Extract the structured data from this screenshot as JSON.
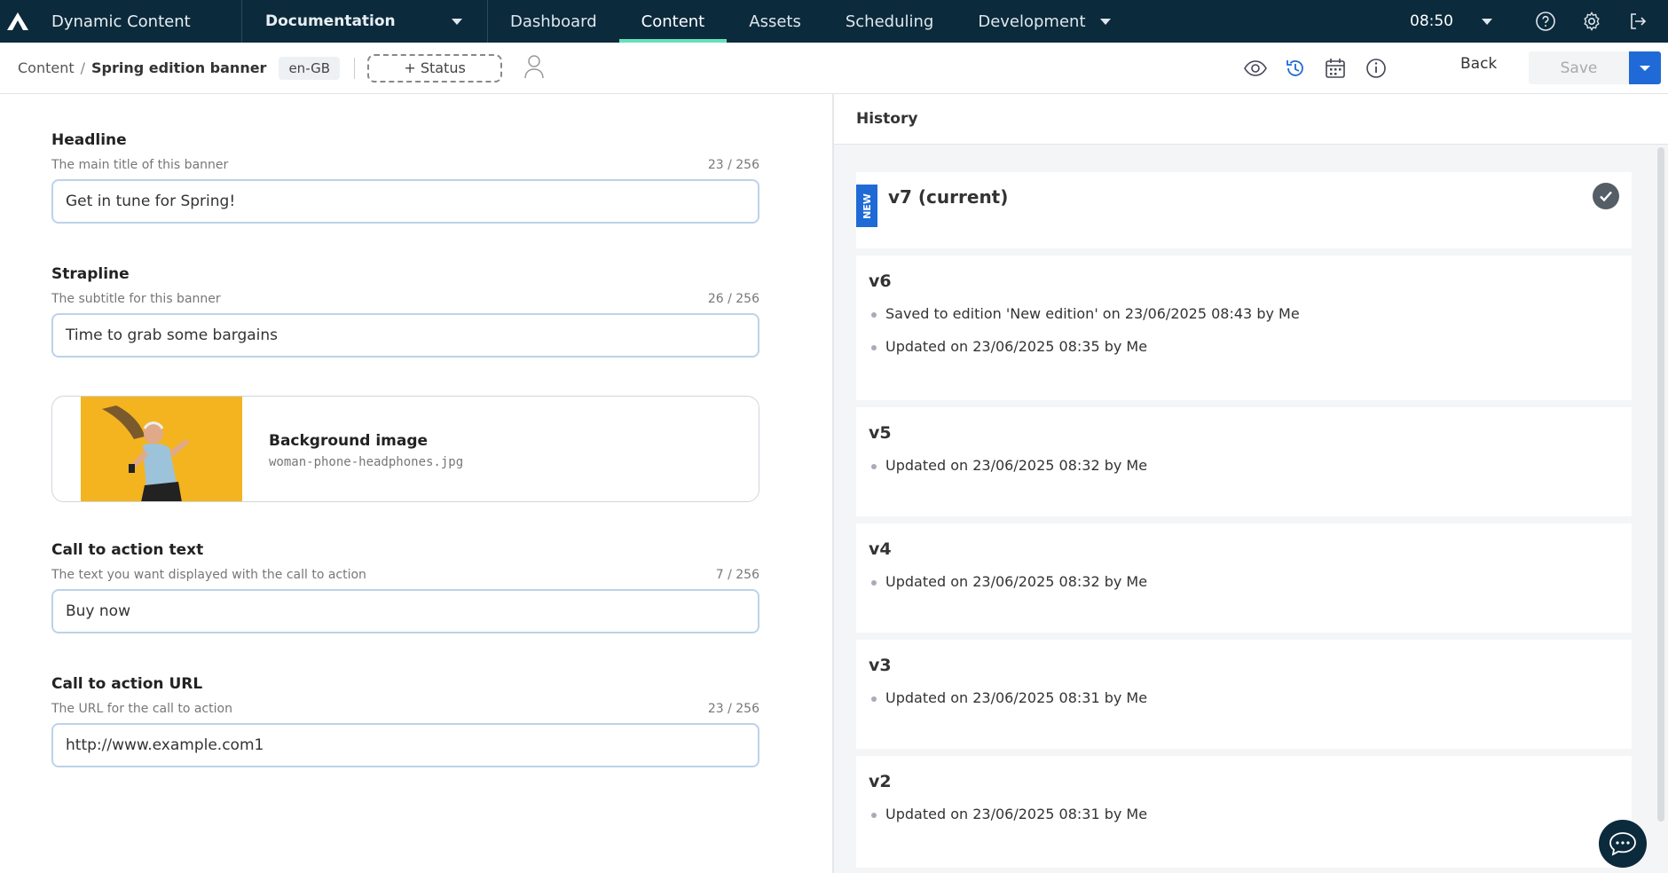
{
  "app": {
    "title": "Dynamic Content",
    "hub": "Documentation"
  },
  "nav": {
    "tabs": [
      "Dashboard",
      "Content",
      "Assets",
      "Scheduling",
      "Development"
    ],
    "active": "Content"
  },
  "clock": "08:50",
  "breadcrumb": {
    "root": "Content",
    "separator": "/",
    "current": "Spring edition banner"
  },
  "locale": "en-GB",
  "toolbar": {
    "status_label": "+ Status",
    "back_label": "Back",
    "save_label": "Save"
  },
  "form": {
    "headline": {
      "label": "Headline",
      "description": "The main title of this banner",
      "count": "23 / 256",
      "value": "Get in tune for Spring!"
    },
    "strapline": {
      "label": "Strapline",
      "description": "The subtitle for this banner",
      "count": "26 / 256",
      "value": "Time to grab some bargains"
    },
    "background_image": {
      "label": "Background image",
      "filename": "woman-phone-headphones.jpg"
    },
    "cta_text": {
      "label": "Call to action text",
      "description": "The text you want displayed with the call to action",
      "count": "7 / 256",
      "value": "Buy now"
    },
    "cta_url": {
      "label": "Call to action URL",
      "description": "The URL for the call to action",
      "count": "23 / 256",
      "value": "http://www.example.com1"
    }
  },
  "history": {
    "title": "History",
    "current": {
      "badge": "NEW",
      "name": "v7 (current)"
    },
    "versions": [
      {
        "name": "v6",
        "entries": [
          "Saved to edition 'New edition' on 23/06/2025 08:43 by Me",
          "Updated on 23/06/2025 08:35 by Me"
        ]
      },
      {
        "name": "v5",
        "entries": [
          "Updated on 23/06/2025 08:32 by Me"
        ]
      },
      {
        "name": "v4",
        "entries": [
          "Updated on 23/06/2025 08:32 by Me"
        ]
      },
      {
        "name": "v3",
        "entries": [
          "Updated on 23/06/2025 08:31 by Me"
        ]
      },
      {
        "name": "v2",
        "entries": [
          "Updated on 23/06/2025 08:31 by Me"
        ]
      }
    ]
  },
  "colors": {
    "nav_bg": "#0b2a3c",
    "active_tab_underline": "#64e0bb",
    "primary": "#1f6ad6",
    "image_bg": "#f4b41f"
  },
  "icons": [
    "amplience-logo",
    "help-icon",
    "settings-icon",
    "logout-icon",
    "user-icon",
    "preview-eye-icon",
    "history-icon",
    "calendar-icon",
    "info-icon",
    "check-icon",
    "chat-icon"
  ]
}
